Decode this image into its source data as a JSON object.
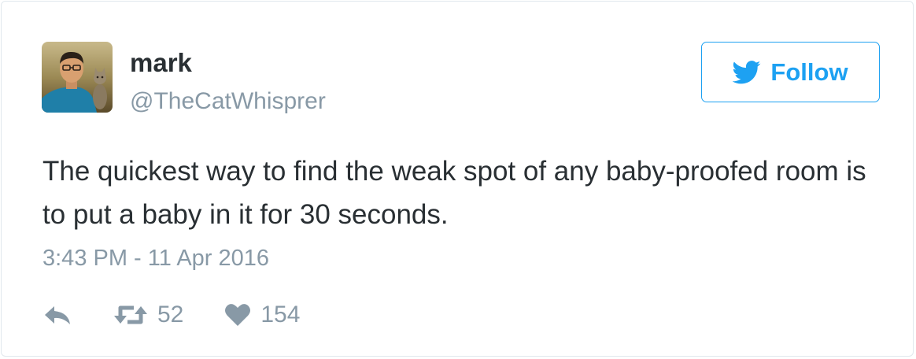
{
  "tweet": {
    "user": {
      "name": "mark",
      "handle": "@TheCatWhisprer",
      "avatar_icon": "profile-photo-man-with-cat"
    },
    "follow_button": {
      "label": "Follow",
      "icon": "twitter-bird-icon",
      "color": "#1da1f2"
    },
    "text": "The quickest way to find the weak spot of any baby-proofed room is to put a baby in it for 30 seconds.",
    "timestamp": "3:43 PM - 11 Apr 2016",
    "actions": {
      "reply_icon": "reply-icon",
      "retweet_icon": "retweet-icon",
      "retweet_count": "52",
      "like_icon": "heart-icon",
      "like_count": "154"
    }
  }
}
